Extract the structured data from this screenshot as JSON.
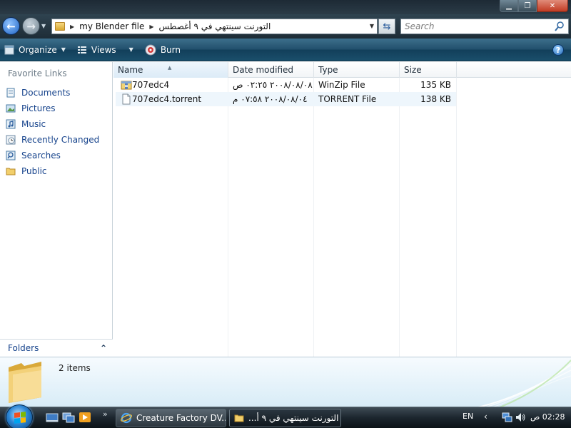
{
  "window": {
    "controls": {
      "minimize": "▁",
      "maximize": "❐",
      "close": "✕"
    }
  },
  "address_bar": {
    "back_icon": "back-arrow-icon",
    "forward_icon": "forward-arrow-icon",
    "breadcrumbs": [
      "my Blender file",
      "التورنت سينتهي في ٩ أغصطس"
    ],
    "search_placeholder": "Search"
  },
  "toolbar": {
    "organize_label": "Organize",
    "views_label": "Views",
    "burn_label": "Burn",
    "help_label": "?"
  },
  "sidebar": {
    "favorite_links_title": "Favorite Links",
    "items": [
      {
        "label": "Documents",
        "icon": "documents-icon"
      },
      {
        "label": "Pictures",
        "icon": "pictures-icon"
      },
      {
        "label": "Music",
        "icon": "music-icon"
      },
      {
        "label": "Recently Changed",
        "icon": "recently-changed-icon"
      },
      {
        "label": "Searches",
        "icon": "searches-icon"
      },
      {
        "label": "Public",
        "icon": "public-folder-icon"
      }
    ],
    "folders_label": "Folders"
  },
  "file_list": {
    "columns": [
      "Name",
      "Date modified",
      "Type",
      "Size"
    ],
    "rows": [
      {
        "name": "707edc4",
        "date": "٢٠٠٨/٠٨/٠٨ ٠٢:٢٥ ص",
        "type": "WinZip File",
        "size": "135 KB",
        "icon": "zip-file-icon"
      },
      {
        "name": "707edc4.torrent",
        "date": "٢٠٠٨/٠٨/٠٤ ٠٧:٥٨ م",
        "type": "TORRENT File",
        "size": "138 KB",
        "icon": "document-file-icon"
      }
    ]
  },
  "details": {
    "item_count": "2 items"
  },
  "taskbar": {
    "tasks": [
      {
        "label": "Creature Factory DV...",
        "icon": "internet-explorer-icon"
      },
      {
        "label": "التورنت سينتهي في ٩ أ...",
        "icon": "folder-icon"
      }
    ],
    "language": "EN",
    "clock": "02:28 ص"
  },
  "colors": {
    "link_blue": "#15428b",
    "toolbar_dark": "#1a4e6b",
    "selection_blue": "#eef6fc"
  }
}
